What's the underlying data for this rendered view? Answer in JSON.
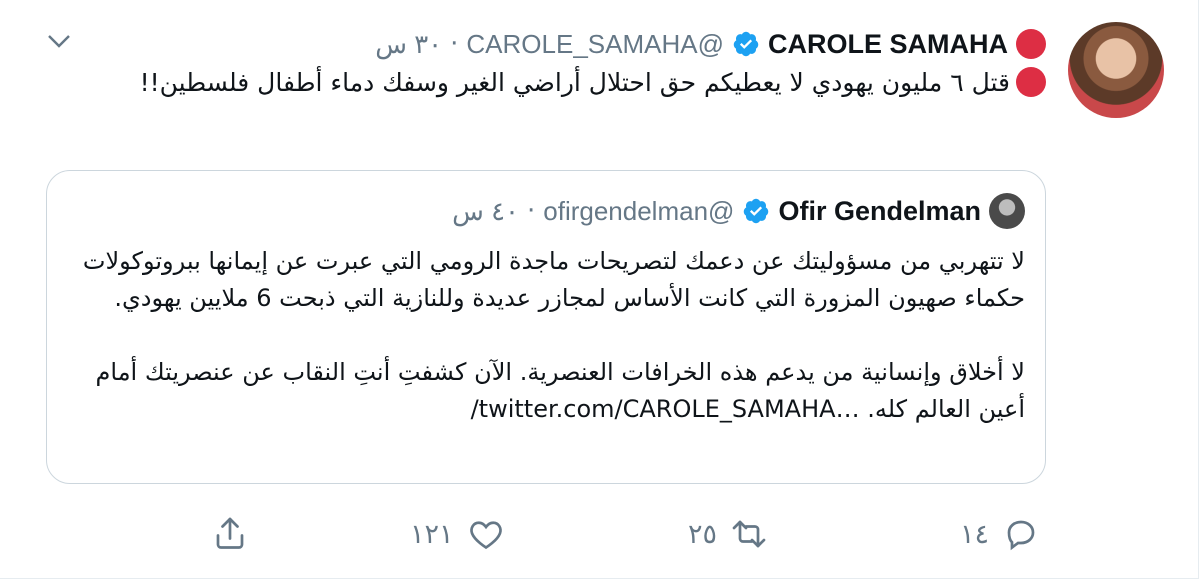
{
  "tweet": {
    "display_name": "CAROLE SAMAHA",
    "handle": "@CAROLE_SAMAHA",
    "time": "٣٠ س",
    "text": "قتل ٦ مليون يهودي لا يعطيكم حق احتلال أراضي الغير  وسفك دماء أطفال فلسطين!!",
    "emoji": "red-circle"
  },
  "quoted": {
    "display_name": "Ofir Gendelman",
    "handle": "@ofirgendelman",
    "time": "٤٠ س",
    "text": "لا تتهربي من مسؤوليتك عن دعمك لتصريحات ماجدة الرومي التي عبرت عن إيمانها ببروتوكولات حكماء صهيون المزورة التي كانت الأساس لمجازر عديدة وللنازية التي ذبحت 6 ملايين يهودي.\n\nلا أخلاق وإنسانية من يدعم هذه الخرافات العنصرية. الآن كشفتِ أنتِ النقاب عن عنصريتك أمام أعين العالم كله. …twitter.com/CAROLE_SAMAHA/"
  },
  "actions": {
    "reply_count": "١٤",
    "retweet_count": "٢٥",
    "like_count": "١٢١"
  },
  "colors": {
    "verified": "#1da1f2",
    "red_emoji": "#dd2e44",
    "muted": "#657786"
  }
}
